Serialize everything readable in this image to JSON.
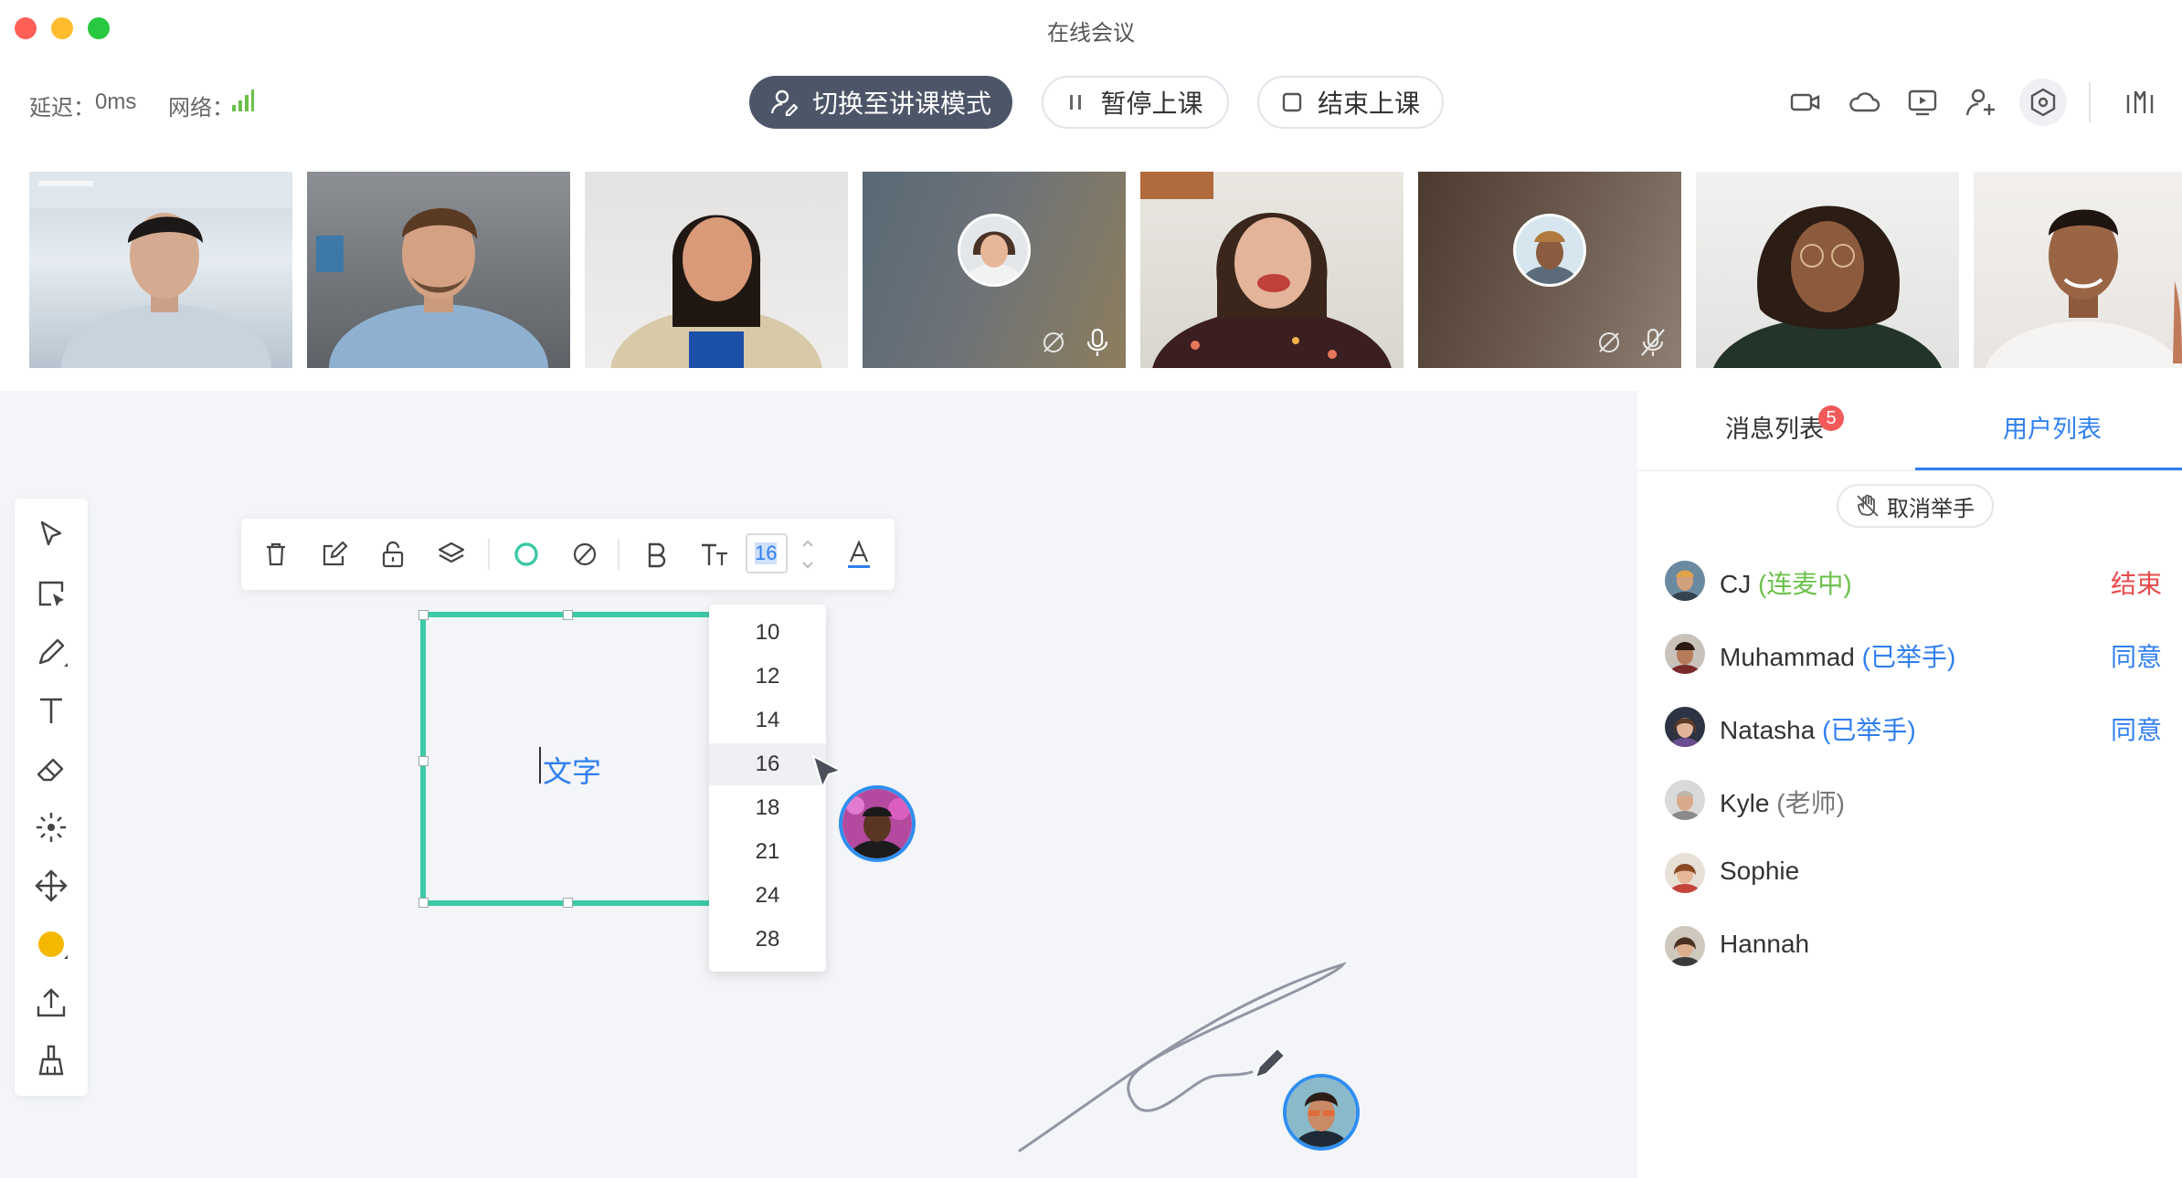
{
  "window": {
    "title": "在线会议"
  },
  "status": {
    "latency_label": "延迟：",
    "latency_value": "0ms",
    "network_label": "网络："
  },
  "controls": {
    "switch_mode": "切换至讲课模式",
    "pause": "暂停上课",
    "end": "结束上课"
  },
  "toolbar_icons": [
    "camera-icon",
    "cloud-icon",
    "screen-share-icon",
    "add-user-icon",
    "settings-icon",
    "equalizer-icon"
  ],
  "side_tools": [
    "pointer-icon",
    "select-icon",
    "pen-icon",
    "text-icon",
    "eraser-icon",
    "laser-icon",
    "move-icon",
    "color-icon",
    "upload-icon",
    "clear-icon"
  ],
  "format_bar": {
    "font_size": "16"
  },
  "canvas": {
    "text": "文字"
  },
  "font_sizes": [
    "10",
    "12",
    "14",
    "16",
    "18",
    "21",
    "24",
    "28"
  ],
  "font_size_selected": "16",
  "panel": {
    "tab_messages": "消息列表",
    "tab_messages_badge": "5",
    "tab_users": "用户列表",
    "cancel_hand": "取消举手",
    "users": [
      {
        "name": "CJ",
        "tag": "(连麦中)",
        "tag_color": "#6cc04a",
        "action": "结束",
        "action_color": "#e8494b"
      },
      {
        "name": "Muhammad",
        "tag": "(已举手)",
        "tag_color": "#2f7ff0",
        "action": "同意",
        "action_color": "#2f7ff0"
      },
      {
        "name": "Natasha",
        "tag": "(已举手)",
        "tag_color": "#2f7ff0",
        "action": "同意",
        "action_color": "#2f7ff0"
      },
      {
        "name": "Kyle",
        "tag": "(老师)",
        "tag_color": "#777777",
        "action": "",
        "action_color": "#2f7ff0"
      },
      {
        "name": "Sophie",
        "tag": "",
        "tag_color": "#777777",
        "action": "",
        "action_color": "#2f7ff0"
      },
      {
        "name": "Hannah",
        "tag": "",
        "tag_color": "#777777",
        "action": "",
        "action_color": "#2f7ff0"
      }
    ]
  },
  "colors": {
    "accent": "#2f7ff0",
    "dark_button": "#4d5669",
    "selection": "#3cc9a6",
    "danger": "#e8494b",
    "signal": "#6cc04a"
  }
}
